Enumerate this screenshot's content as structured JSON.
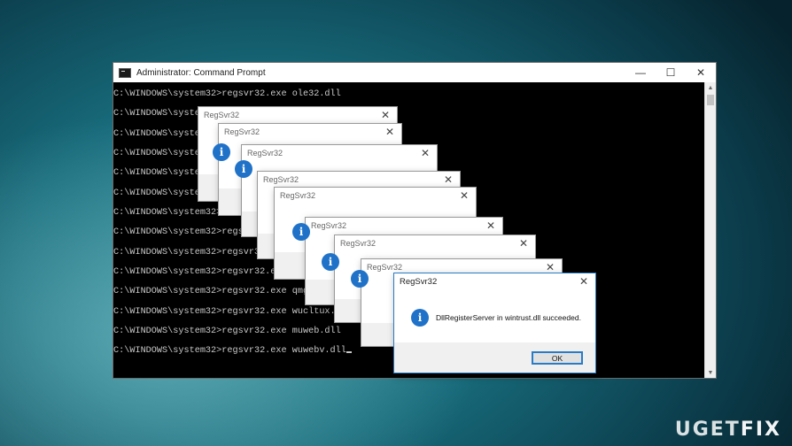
{
  "cmd": {
    "title": "Administrator: Command Prompt",
    "controls": {
      "minimize": "—",
      "maximize": "☐",
      "close": "✕"
    },
    "lines": [
      "C:\\WINDOWS\\system32>regsvr32.exe ole32.dll",
      "C:\\WINDOWS\\system",
      "C:\\WINDOWS\\system",
      "C:\\WINDOWS\\system",
      "C:\\WINDOWS\\system",
      "C:\\WINDOWS\\system32>r",
      "C:\\WINDOWS\\system32>regsvr",
      "C:\\WINDOWS\\system32>regsvr32.e",
      "C:\\WINDOWS\\system32>regsvr32.exe",
      "C:\\WINDOWS\\system32>regsvr32.exe qmgr.d",
      "C:\\WINDOWS\\system32>regsvr32.exe qmgrpr",
      "C:\\WINDOWS\\system32>regsvr32.exe wucltux.dll",
      "C:\\WINDOWS\\system32>regsvr32.exe muweb.dll",
      "C:\\WINDOWS\\system32>regsvr32.exe wuwebv.dll"
    ]
  },
  "dialog": {
    "title": "RegSvr32",
    "close": "✕",
    "info_glyph": "i",
    "message": "DllRegisterServer in wintrust.dll succeeded.",
    "ok_label": "OK"
  },
  "logo": {
    "left": "UG",
    "mid": "E",
    "right": "T",
    "fix": "FIX"
  },
  "icons": [
    "cmd-icon",
    "info-icon",
    "close-icon",
    "minimize-icon",
    "maximize-icon"
  ],
  "colors": {
    "accent": "#2a7bc6",
    "info": "#1f72c8"
  }
}
